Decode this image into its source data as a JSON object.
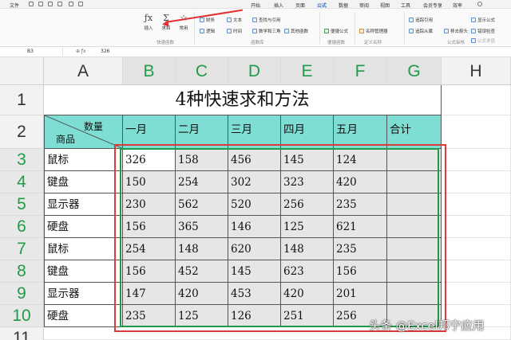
{
  "menubar": {
    "file": "文件",
    "tabs": [
      "开始",
      "插入",
      "页面",
      "公式",
      "数据",
      "审阅",
      "视图",
      "工具",
      "会员专享",
      "效率"
    ],
    "active_tab": "公式"
  },
  "ribbon": {
    "insert_fn": "插入",
    "autosum": "求和",
    "common": "常用",
    "quick_group": "快速函数",
    "fn_row1": [
      "财务",
      "逻辑"
    ],
    "fn_row2": [
      "文本",
      "时间"
    ],
    "lookup": "查找与引用",
    "math": "数学和三角",
    "other": "其他函数",
    "fn_group": "函数库",
    "quick_formula": "便捷公式",
    "quick_formula_group": "便捷函数",
    "name_mgr": "名称管理器",
    "define_group": "定义名称",
    "trace_prec": "追踪引用",
    "trace_dep": "追踪从属",
    "remove_arrows": "移去箭头",
    "show_formula": "显示公式",
    "error_check": "错误检查",
    "eval_formula": "公式求值",
    "audit_group": "公式审核"
  },
  "formula_bar": {
    "name_box": "B3",
    "value": "326"
  },
  "columns": [
    "A",
    "B",
    "C",
    "D",
    "E",
    "F",
    "G",
    "H"
  ],
  "rows": [
    "1",
    "2",
    "3",
    "4",
    "5",
    "6",
    "7",
    "8",
    "9",
    "10",
    "11"
  ],
  "sheet": {
    "title": "4种快速求和方法",
    "diag_top": "数量",
    "diag_bottom": "商品",
    "headers": [
      "一月",
      "二月",
      "三月",
      "四月",
      "五月",
      "合计"
    ],
    "data": [
      {
        "item": "鼠标",
        "values": [
          "326",
          "158",
          "456",
          "145",
          "124"
        ]
      },
      {
        "item": "键盘",
        "values": [
          "150",
          "254",
          "302",
          "323",
          "420"
        ]
      },
      {
        "item": "显示器",
        "values": [
          "230",
          "562",
          "520",
          "256",
          "235"
        ]
      },
      {
        "item": "硬盘",
        "values": [
          "156",
          "365",
          "146",
          "125",
          "621"
        ]
      },
      {
        "item": "鼠标",
        "values": [
          "254",
          "148",
          "620",
          "148",
          "235"
        ]
      },
      {
        "item": "键盘",
        "values": [
          "156",
          "452",
          "145",
          "623",
          "156"
        ]
      },
      {
        "item": "显示器",
        "values": [
          "147",
          "420",
          "453",
          "420",
          "201"
        ]
      },
      {
        "item": "硬盘",
        "values": [
          "235",
          "125",
          "126",
          "251",
          "256"
        ]
      }
    ]
  },
  "watermark": "头条 @Excel邦宁应用",
  "colors": {
    "header_fill": "#7fded4",
    "selection": "#1e9a4a",
    "annotation": "#dd3b3b",
    "data_fill": "#e6e6e6"
  }
}
